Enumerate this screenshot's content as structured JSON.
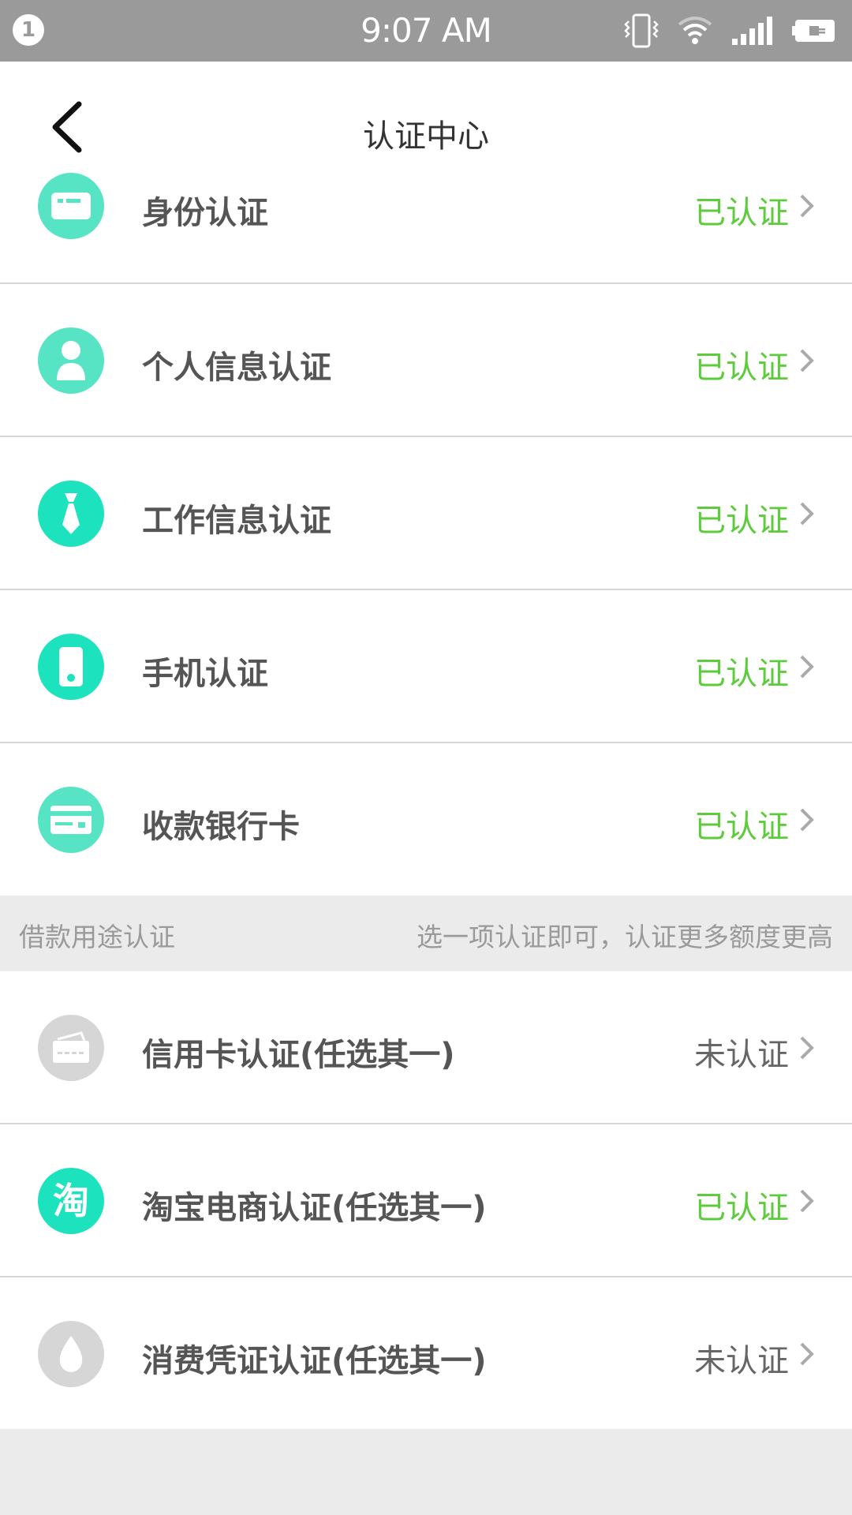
{
  "status_bar": {
    "notification_count": "1",
    "time": "9:07 AM",
    "icons": [
      "vibrate-icon",
      "wifi-icon",
      "signal-icon",
      "battery-icon"
    ]
  },
  "header": {
    "title": "认证中心",
    "back_icon": "chevron-left-icon"
  },
  "colors": {
    "verified": "#5ccc3c",
    "unverified": "#666666",
    "icon_teal": "#1ce3bd",
    "icon_teal_light": "#57e4c4",
    "icon_gray": "#d6d6d6"
  },
  "required_items": [
    {
      "label": "身份认证",
      "status": "已认证",
      "verified": true,
      "icon": "id-card-icon"
    },
    {
      "label": "个人信息认证",
      "status": "已认证",
      "verified": true,
      "icon": "person-icon"
    },
    {
      "label": "工作信息认证",
      "status": "已认证",
      "verified": true,
      "icon": "tie-icon"
    },
    {
      "label": "手机认证",
      "status": "已认证",
      "verified": true,
      "icon": "phone-icon"
    },
    {
      "label": "收款银行卡",
      "status": "已认证",
      "verified": true,
      "icon": "bank-card-icon"
    }
  ],
  "section": {
    "title": "借款用途认证",
    "hint": "选一项认证即可，认证更多额度更高"
  },
  "optional_items": [
    {
      "label": "信用卡认证(任选其一)",
      "status": "未认证",
      "verified": false,
      "icon": "credit-card-icon"
    },
    {
      "label": "淘宝电商认证(任选其一)",
      "status": "已认证",
      "verified": true,
      "icon": "taobao-icon",
      "icon_text": "淘"
    },
    {
      "label": "消费凭证认证(任选其一)",
      "status": "未认证",
      "verified": false,
      "icon": "drop-icon"
    }
  ]
}
